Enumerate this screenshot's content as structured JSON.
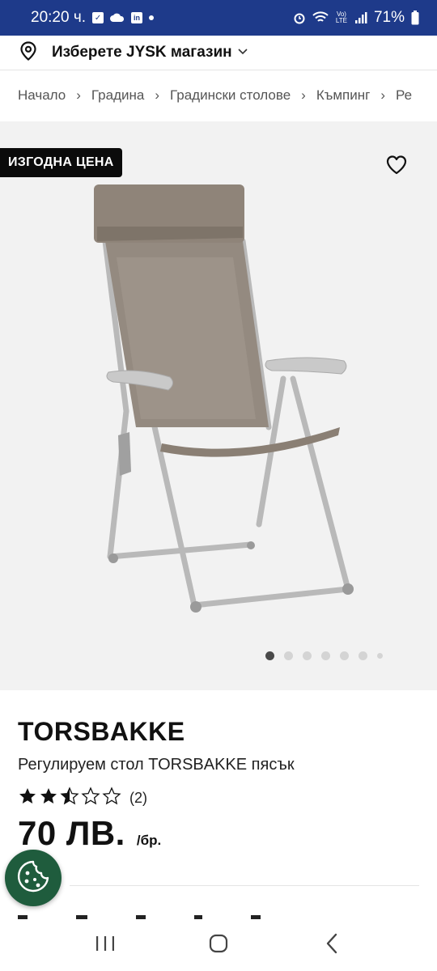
{
  "status_bar": {
    "time": "20:20 ч.",
    "battery": "71%",
    "icons": [
      "check-square-icon",
      "cloud-icon",
      "linkedin-icon",
      "dot-icon",
      "alarm-icon",
      "wifi-icon",
      "volte-icon",
      "signal-icon",
      "battery-icon"
    ]
  },
  "store": {
    "label": "Изберете JYSK магазин",
    "icon": "location-pin-icon"
  },
  "breadcrumb": [
    "Начало",
    "Градина",
    "Градински столове",
    "Къмпинг",
    "Ре"
  ],
  "hero": {
    "badge": "ИЗГОДНА ЦЕНА",
    "favorite_icon": "heart-icon",
    "image_count": 7,
    "active_index": 0
  },
  "product": {
    "brand": "TORSBAKKE",
    "name": "Регулируем стол TORSBAKKE пясък",
    "rating": 2.5,
    "rating_max": 5,
    "review_count": "(2)",
    "price": "70 ЛВ.",
    "unit": "/бр."
  },
  "colors": {
    "status_bar": "#1e3a8a",
    "cookie_button": "#1f5c3d",
    "badge_bg": "#0b0b0b",
    "hero_bg": "#f2f2f2"
  },
  "nav": [
    "recent-apps-icon",
    "home-icon",
    "back-icon"
  ]
}
